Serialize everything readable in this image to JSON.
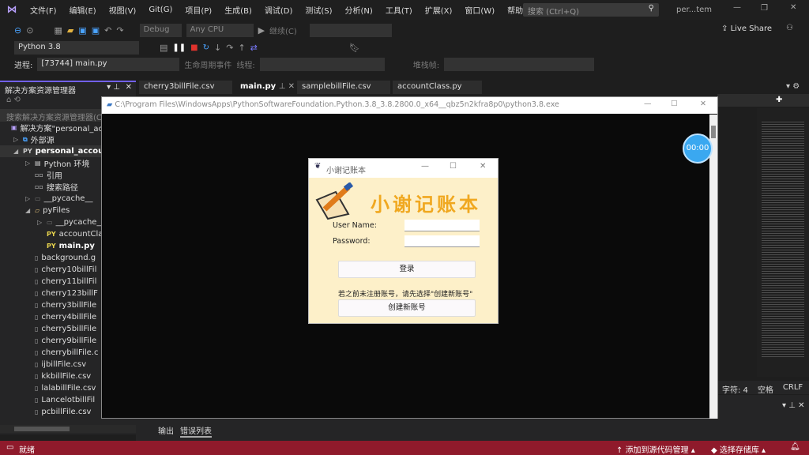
{
  "menubar": {
    "items": [
      "文件(F)",
      "编辑(E)",
      "视图(V)",
      "Git(G)",
      "项目(P)",
      "生成(B)",
      "调试(D)",
      "测试(S)",
      "分析(N)",
      "工具(T)",
      "扩展(X)",
      "窗口(W)",
      "帮助(H)"
    ],
    "search_placeholder": "搜索 (Ctrl+Q)",
    "solution_short": "per...tem"
  },
  "toolbar": {
    "config": "Debug",
    "platform": "Any CPU",
    "continue": "继续(C)",
    "live_share": "Live Share",
    "python_env": "Python 3.8",
    "process_label": "进程:",
    "process": "[73744] main.py",
    "lifecycle": "生命周期事件",
    "thread_label": "线程:",
    "stack_label": "堆栈帧:"
  },
  "solution_explorer": {
    "title": "解决方案资源管理器",
    "search_placeholder": "搜索解决方案资源管理器(C",
    "items": [
      {
        "label": "解决方案\"personal_ac",
        "indent": 0,
        "icon": "solution"
      },
      {
        "label": "外部源",
        "indent": 1,
        "icon": "external"
      },
      {
        "label": "personal_accoun",
        "indent": 1,
        "icon": "py-project",
        "bold": true
      },
      {
        "label": "Python 环境",
        "indent": 2,
        "icon": "env"
      },
      {
        "label": "引用",
        "indent": 2,
        "icon": "ref"
      },
      {
        "label": "搜索路径",
        "indent": 2,
        "icon": "ref"
      },
      {
        "label": "__pycache__",
        "indent": 2,
        "icon": "folder"
      },
      {
        "label": "pyFiles",
        "indent": 2,
        "icon": "folder-open"
      },
      {
        "label": "__pycache__",
        "indent": 3,
        "icon": "folder"
      },
      {
        "label": "accountCla",
        "indent": 3,
        "icon": "py"
      },
      {
        "label": "main.py",
        "indent": 3,
        "icon": "py",
        "bold": true
      },
      {
        "label": "background.g",
        "indent": 2,
        "icon": "file"
      },
      {
        "label": "cherry10billFil",
        "indent": 2,
        "icon": "file"
      },
      {
        "label": "cherry11billFil",
        "indent": 2,
        "icon": "file"
      },
      {
        "label": "cherry123billF",
        "indent": 2,
        "icon": "file"
      },
      {
        "label": "cherry3billFile",
        "indent": 2,
        "icon": "file"
      },
      {
        "label": "cherry4billFile",
        "indent": 2,
        "icon": "file"
      },
      {
        "label": "cherry5billFile",
        "indent": 2,
        "icon": "file"
      },
      {
        "label": "cherry9billFile",
        "indent": 2,
        "icon": "file"
      },
      {
        "label": "cherrybillFile.c",
        "indent": 2,
        "icon": "file"
      },
      {
        "label": "ijbillFile.csv",
        "indent": 2,
        "icon": "file"
      },
      {
        "label": "kkbillFile.csv",
        "indent": 2,
        "icon": "file"
      },
      {
        "label": "lalabillFile.csv",
        "indent": 2,
        "icon": "file"
      },
      {
        "label": "LancelotbillFil",
        "indent": 2,
        "icon": "file"
      },
      {
        "label": "pcbillFile.csv",
        "indent": 2,
        "icon": "file"
      }
    ]
  },
  "editor_tabs": [
    {
      "label": "cherry3billFile.csv"
    },
    {
      "label": "main.py",
      "active": true
    },
    {
      "label": "samplebillFile.csv"
    },
    {
      "label": "accountClass.py"
    }
  ],
  "console": {
    "title": "C:\\Program Files\\WindowsApps\\PythonSoftwareFoundation.Python.3.8_3.8.2800.0_x64__qbz5n2kfra8p0\\python3.8.exe"
  },
  "timer": "00:00",
  "dialog": {
    "title": "小谢记账本",
    "banner": "小谢记账本",
    "username_label": "User Name:",
    "password_label": "Password:",
    "username_value": "",
    "password_value": "",
    "login_button": "登录",
    "hint": "若之前未注册账号，请先选择\"创建新账号\"",
    "register_button": "创建新账号"
  },
  "editor_status": {
    "chars": "字符: 4",
    "spaces": "空格",
    "eol": "CRLF"
  },
  "bottom_panel": {
    "tabs": [
      "输出",
      "错误列表"
    ],
    "active": "错误列表"
  },
  "statusbar": {
    "ready": "就绪",
    "add_source": "添加到源代码管理",
    "select_repo": "选择存储库"
  },
  "colors": {
    "status_bar": "#8f1a2b",
    "dialog_bg": "#fdf0c9",
    "banner": "#f0a820",
    "timer": "#3aa8f0"
  }
}
